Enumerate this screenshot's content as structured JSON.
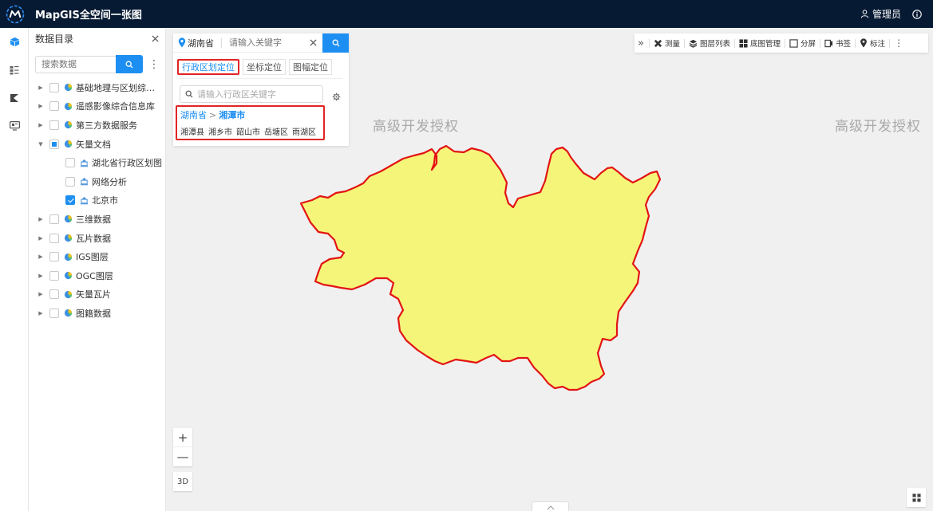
{
  "app": {
    "title": "MapGIS全空间一张图",
    "user": "管理员"
  },
  "rail": {
    "items": [
      "cube-icon",
      "layers-list-icon",
      "model-icon",
      "monitor-icon"
    ]
  },
  "catalog": {
    "title": "数据目录",
    "search_placeholder": "搜索数据",
    "items": [
      {
        "label": "基础地理与区划综合...",
        "state": "none",
        "expanded": false
      },
      {
        "label": "遥感影像综合信息库",
        "state": "none",
        "expanded": false
      },
      {
        "label": "第三方数据服务",
        "state": "none",
        "expanded": false
      },
      {
        "label": "矢量文档",
        "state": "partial",
        "expanded": true
      },
      {
        "label": "湖北省行政区划图",
        "state": "none",
        "child": true
      },
      {
        "label": "网络分析",
        "state": "none",
        "child": true
      },
      {
        "label": "北京市",
        "state": "checked",
        "child": true
      },
      {
        "label": "三维数据",
        "state": "none",
        "expanded": false
      },
      {
        "label": "瓦片数据",
        "state": "none",
        "expanded": false
      },
      {
        "label": "IGS图层",
        "state": "none",
        "expanded": false
      },
      {
        "label": "OGC图层",
        "state": "none",
        "expanded": false
      },
      {
        "label": "矢量瓦片",
        "state": "none",
        "expanded": false
      },
      {
        "label": "图籍数据",
        "state": "none",
        "expanded": false
      }
    ]
  },
  "location": {
    "province": "湖南省",
    "keyword_placeholder": "请输入关键字",
    "tabs": [
      {
        "label": "行政区划定位",
        "active": true
      },
      {
        "label": "坐标定位",
        "active": false
      },
      {
        "label": "图幅定位",
        "active": false
      }
    ],
    "admin_placeholder": "请输入行政区关键字",
    "breadcrumb": {
      "province": "湖南省",
      "separator": ">",
      "city": "湘潭市"
    },
    "districts": [
      "湘潭县",
      "湘乡市",
      "韶山市",
      "岳塘区",
      "雨湖区"
    ]
  },
  "toolbar": {
    "items": [
      {
        "label": "测量",
        "icon": "ruler-icon"
      },
      {
        "label": "图层列表",
        "icon": "layers-icon"
      },
      {
        "label": "底图管理",
        "icon": "basemap-grid-icon"
      },
      {
        "label": "分屏",
        "icon": "split-screen-icon"
      },
      {
        "label": "书签",
        "icon": "bookmark-icon"
      },
      {
        "label": "标注",
        "icon": "marker-icon"
      }
    ]
  },
  "map": {
    "watermarks": [
      "高级开发授权",
      "高级开发授权"
    ],
    "region_fill": "#f5f57a",
    "region_stroke": "#e31414",
    "zoom_in": "+",
    "zoom_out": "—",
    "mode_3d": "3D"
  },
  "colors": {
    "accent": "#1e8ff2",
    "topbar": "#071a33",
    "highlight": "#e12424"
  }
}
